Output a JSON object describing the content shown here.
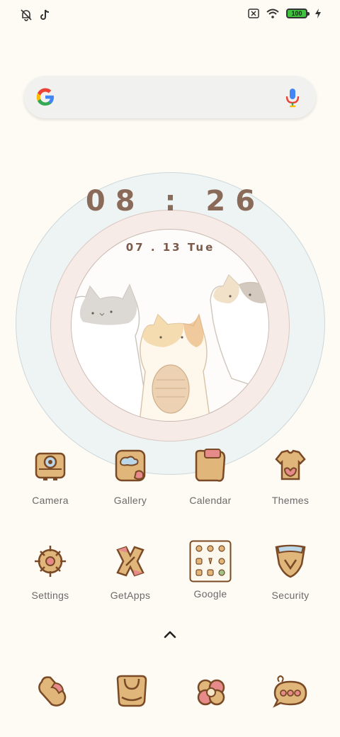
{
  "status_bar": {
    "left_icons": [
      "notifications-muted-icon",
      "tiktok-icon"
    ],
    "right_icons": [
      "sim-none-icon",
      "wifi-icon",
      "battery-icon",
      "charging-icon"
    ],
    "battery_level": "100",
    "colors": {
      "battery_fill": "#3ec33e"
    }
  },
  "search_bar": {
    "icons": [
      "google-logo-icon",
      "microphone-icon"
    ]
  },
  "clock_widget": {
    "time": "08 : 26",
    "date": "07 . 13  Tue",
    "colors": {
      "time": "#8a6a58",
      "outer_ring": "#eef4f4",
      "mid_ring": "#f6ebe6"
    }
  },
  "apps": [
    {
      "label": "Camera",
      "icon": "camera-icon"
    },
    {
      "label": "Gallery",
      "icon": "gallery-icon"
    },
    {
      "label": "Calendar",
      "icon": "calendar-icon"
    },
    {
      "label": "Themes",
      "icon": "themes-icon"
    },
    {
      "label": "Settings",
      "icon": "settings-icon"
    },
    {
      "label": "GetApps",
      "icon": "getapps-icon"
    },
    {
      "label": "Google",
      "icon": "google-folder-icon"
    },
    {
      "label": "Security",
      "icon": "security-icon"
    }
  ],
  "app_drawer_hint": "chevron-up-icon",
  "dock": [
    {
      "icon": "phone-icon"
    },
    {
      "icon": "browser-icon"
    },
    {
      "icon": "browser-flower-icon"
    },
    {
      "icon": "messages-icon"
    }
  ],
  "theme_colors": {
    "background": "#fdfbf4",
    "icon_outline": "#7a4a26",
    "icon_fill": "#e0b67a"
  }
}
